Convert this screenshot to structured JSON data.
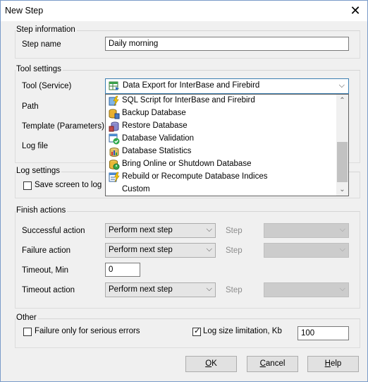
{
  "window": {
    "title": "New Step"
  },
  "step_info": {
    "group_label": "Step information",
    "step_name_label": "Step name",
    "step_name_value": "Daily morning"
  },
  "tool_settings": {
    "group_label": "Tool settings",
    "tool_label": "Tool (Service)",
    "tool_selected": "Data Export for InterBase and Firebird",
    "path_label": "Path",
    "template_label": "Template (Parameters)",
    "log_file_label": "Log file",
    "dropdown_items": [
      {
        "label": "SQL Script for InterBase and Firebird",
        "icon": "sql-script-icon"
      },
      {
        "label": "Backup Database",
        "icon": "backup-database-icon"
      },
      {
        "label": "Restore Database",
        "icon": "restore-database-icon"
      },
      {
        "label": "Database Validation",
        "icon": "database-validation-icon"
      },
      {
        "label": "Database Statistics",
        "icon": "database-statistics-icon"
      },
      {
        "label": "Bring Online or Shutdown Database",
        "icon": "online-shutdown-icon"
      },
      {
        "label": "Rebuild or Recompute Database Indices",
        "icon": "rebuild-indices-icon"
      },
      {
        "label": "Custom",
        "icon": ""
      }
    ]
  },
  "log_settings": {
    "group_label": "Log settings",
    "save_screen_label": "Save screen to log",
    "save_screen_checked": false
  },
  "finish_actions": {
    "group_label": "Finish actions",
    "successful_label": "Successful action",
    "successful_value": "Perform next step",
    "failure_label": "Failure action",
    "failure_value": "Perform next step",
    "timeout_min_label": "Timeout, Min",
    "timeout_min_value": "0",
    "timeout_action_label": "Timeout action",
    "timeout_action_value": "Perform next step",
    "step_label": "Step"
  },
  "other": {
    "group_label": "Other",
    "failure_serious_label": "Failure only for serious errors",
    "failure_serious_checked": false,
    "log_size_label": "Log size limitation, Kb",
    "log_size_checked": true,
    "log_size_value": "100"
  },
  "buttons": {
    "ok": {
      "mnemonic": "O",
      "rest": "K"
    },
    "cancel": {
      "mnemonic": "C",
      "rest": "ancel"
    },
    "help": {
      "mnemonic": "H",
      "rest": "elp"
    }
  }
}
